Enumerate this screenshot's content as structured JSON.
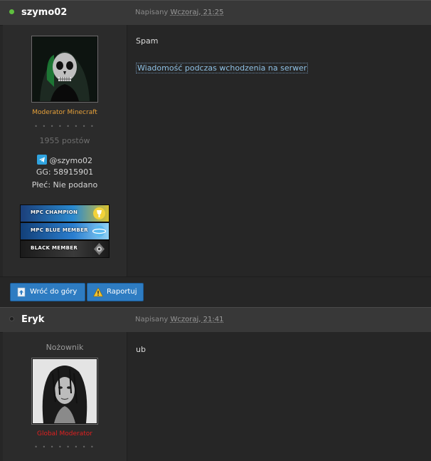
{
  "posts": [
    {
      "author": "szymo02",
      "status_color": "#5fbf3f",
      "posted_prefix": "Napisany",
      "posted_date": "Wczoraj, 21:25",
      "rank": "Moderator Minecraft",
      "rank_color": "#e8a23a",
      "pips": "• • • • • • • •",
      "post_count": "1955 postów",
      "telegram": "@szymo02",
      "gg": "GG: 58915901",
      "gender": "Płeć: Nie podano",
      "badges": [
        {
          "label": "MPC CHAMPION",
          "icon": "trophy-icon"
        },
        {
          "label": "MPC BLUE MEMBER",
          "icon": "planet-icon"
        },
        {
          "label": "BLACK MEMBER",
          "icon": "shield-icon"
        }
      ],
      "content_text": "Spam",
      "content_link": "Wiadomość podczas wchodzenia na serwer"
    },
    {
      "author": "Eryk",
      "status_color": "#3a3a3a",
      "posted_prefix": "Napisany",
      "posted_date": "Wczoraj, 21:41",
      "title_above": "Nożownik",
      "rank": "Global Moderator",
      "rank_color": "#e02020",
      "pips": "• • • • • • • •",
      "content_text": "ub"
    }
  ],
  "footer": {
    "back_to_top": "Wróć do góry",
    "report": "Raportuj"
  }
}
